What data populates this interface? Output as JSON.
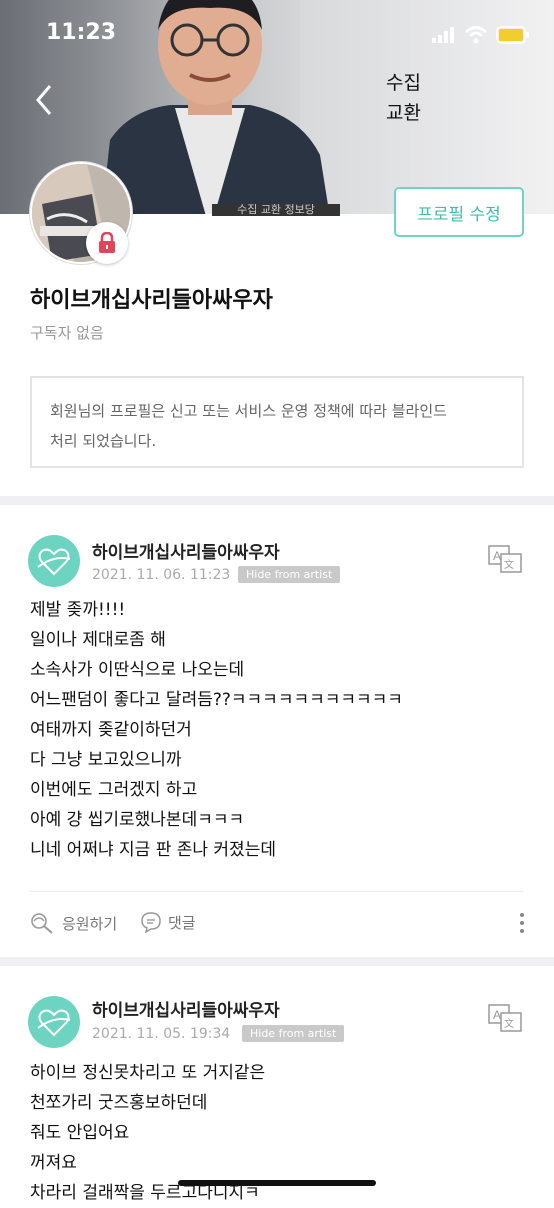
{
  "status_bar": {
    "time": "11:23"
  },
  "header": {
    "overlay_line1": "수집",
    "overlay_line2": "교환",
    "caption": "수집 교환 정보당"
  },
  "profile": {
    "name": "하이브개십사리들아싸우자",
    "subscribers": "구독자 없음",
    "edit_button": "프로필 수정",
    "notice_line1": "회원님의 프로필은 신고 또는 서비스 운영 정책에 따라 블라인드",
    "notice_line2": "처리 되었습니다."
  },
  "posts": [
    {
      "author": "하이브개십사리들아싸우자",
      "date": "2021. 11. 06. 11:23",
      "badge": "Hide from artist",
      "lines": [
        "제발 좆까!!!!",
        "일이나 제대로좀 해",
        "소속사가 이딴식으로 나오는데",
        "어느팬덤이 좋다고 달려듬??ㅋㅋㅋㅋㅋㅋㅋㅋㅋㅋㅋ",
        "여태까지 좆같이하던거",
        "다 그냥 보고있으니까",
        "이번에도 그러겠지 하고",
        "아예 걍 씹기로했나본데ㅋㅋㅋ",
        "니네 어쩌냐 지금 판 존나 커졌는데"
      ],
      "cheer_label": "응원하기",
      "comment_label": "댓글"
    },
    {
      "author": "하이브개십사리들아싸우자",
      "date": "2021. 11. 05. 19:34",
      "badge": "Hide from artist",
      "lines": [
        "하이브 정신못차리고 또 거지같은",
        "천쪼가리 굿즈홍보하던데",
        "줘도 안입어요",
        "꺼져요",
        "차라리 걸래짝을 두르고다니지ㅋ"
      ]
    }
  ],
  "colors": {
    "accent": "#3fbfae",
    "badge": "#c9c9c9",
    "lock": "#e0455a"
  }
}
